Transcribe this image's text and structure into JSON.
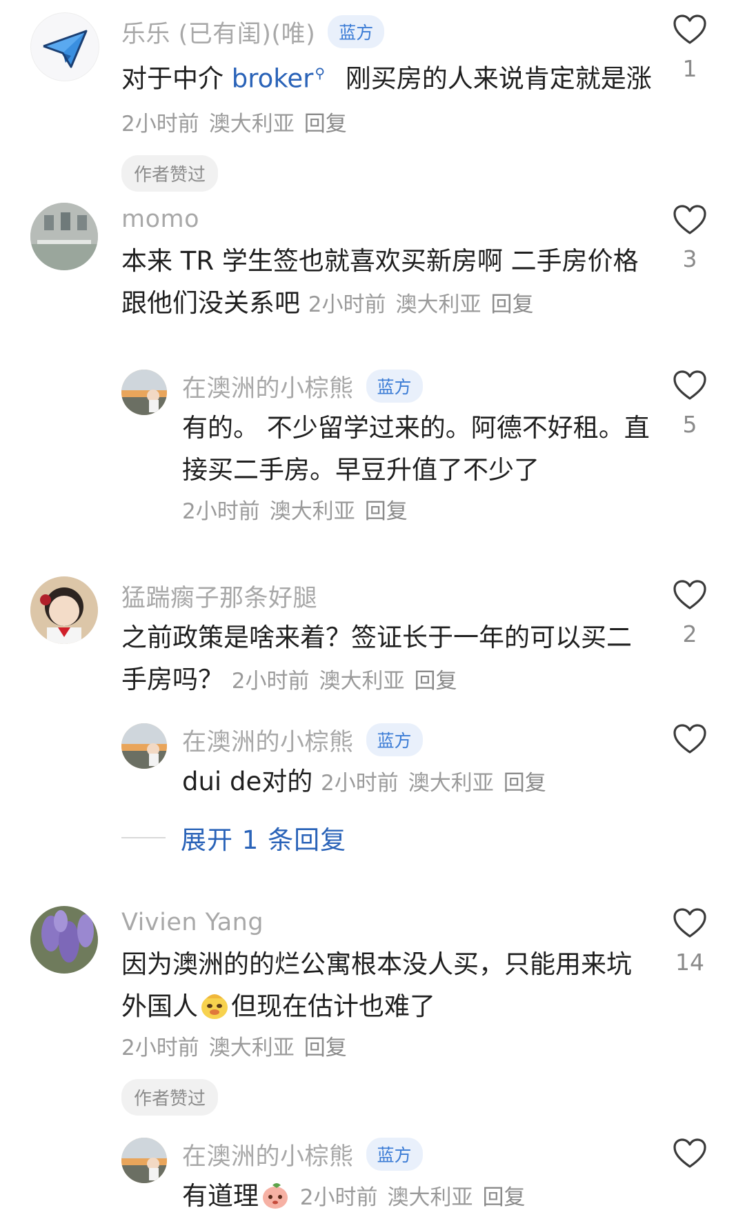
{
  "comments": [
    {
      "name": "乐乐 (已有闺)(唯)",
      "badge": "蓝方",
      "text_before": "对于中介 ",
      "link": "broker",
      "text_after": " 刚买房的人来说肯定就是涨",
      "time": "2小时前",
      "location": "澳大利亚",
      "reply": "回复",
      "author_liked": "作者赞过",
      "likes": "1"
    },
    {
      "name": "momo",
      "text": "本来 TR 学生签也就喜欢买新房啊 二手房价格跟他们没关系吧",
      "time": "2小时前",
      "location": "澳大利亚",
      "reply": "回复",
      "likes": "3",
      "replies": [
        {
          "name": "在澳洲的小棕熊",
          "badge": "蓝方",
          "text": "有的。 不少留学过来的。阿德不好租。直接买二手房。早豆升值了不少了",
          "time": "2小时前",
          "location": "澳大利亚",
          "reply": "回复",
          "likes": "5"
        }
      ]
    },
    {
      "name": "猛踹瘸子那条好腿",
      "text": "之前政策是啥来着？签证长于一年的可以买二手房吗？",
      "time": "2小时前",
      "location": "澳大利亚",
      "reply": "回复",
      "likes": "2",
      "replies": [
        {
          "name": "在澳洲的小棕熊",
          "badge": "蓝方",
          "text": "dui de对的",
          "time": "2小时前",
          "location": "澳大利亚",
          "reply": "回复",
          "likes": ""
        }
      ],
      "expand": "展开 1 条回复"
    },
    {
      "name": "Vivien Yang",
      "text_before": "因为澳洲的的烂公寓根本没人买，只能用来坑外国人",
      "text_after": "但现在估计也难了",
      "time": "2小时前",
      "location": "澳大利亚",
      "reply": "回复",
      "author_liked": "作者赞过",
      "likes": "14",
      "replies": [
        {
          "name": "在澳洲的小棕熊",
          "badge": "蓝方",
          "text": "有道理",
          "time": "2小时前",
          "location": "澳大利亚",
          "reply": "回复",
          "likes": ""
        }
      ]
    }
  ],
  "colors": {
    "name": "#a8a8a8",
    "badge_text": "#3a7bd5",
    "badge_bg": "#e9f0fb",
    "link": "#2a63b8",
    "meta": "#9a9a9a"
  }
}
